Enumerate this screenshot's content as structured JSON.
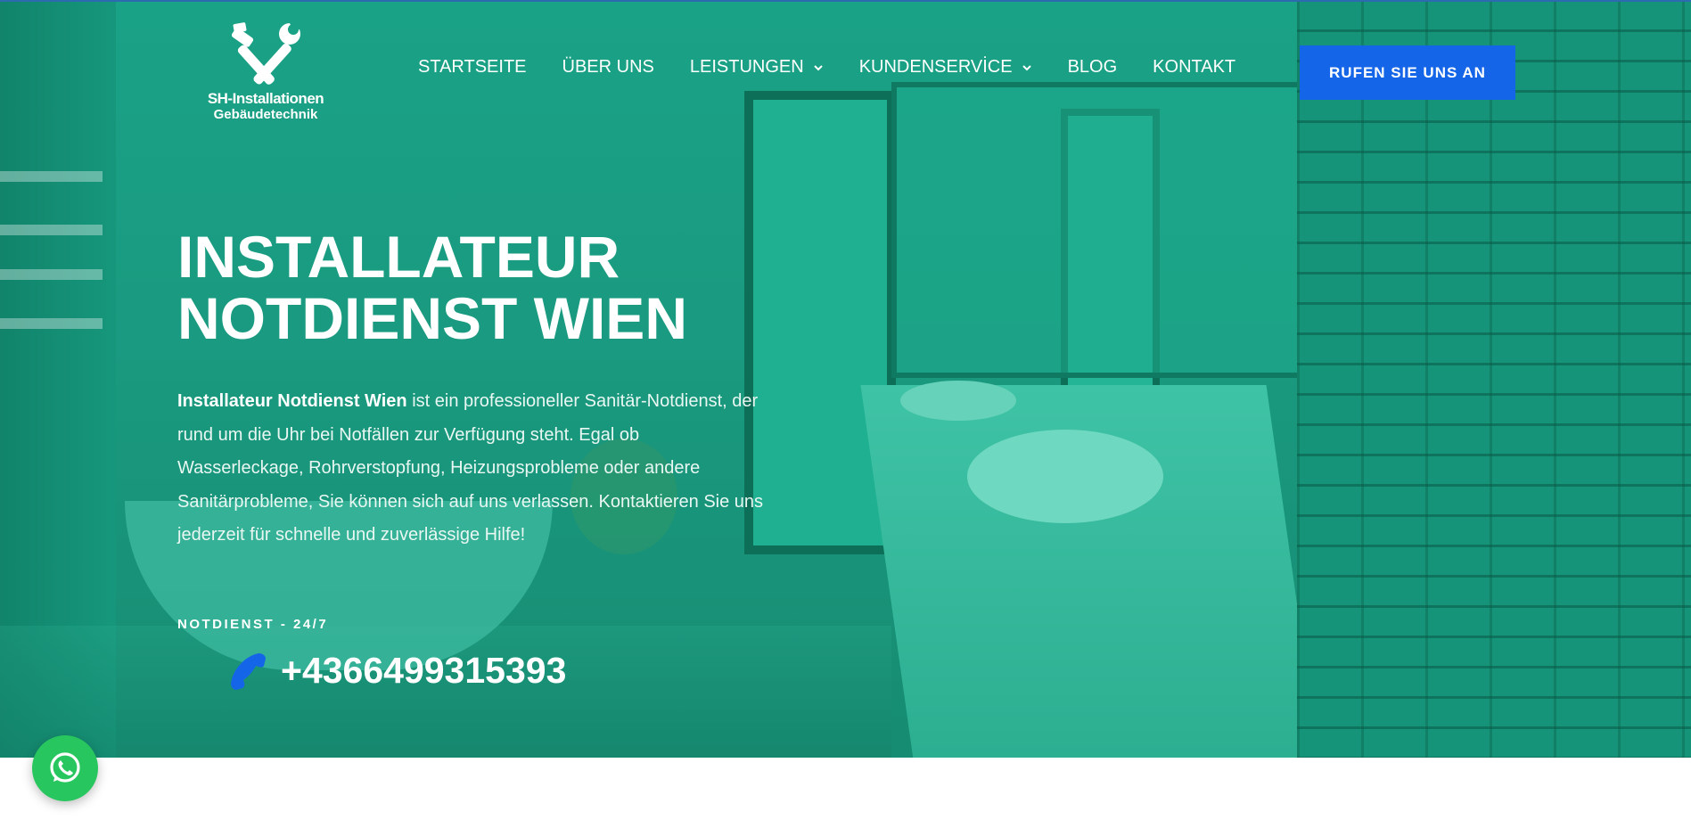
{
  "logo": {
    "line1": "SH-Installationen",
    "line2": "Gebäudetechnik",
    "icon": "wrench-and-pipe-wrench-icon"
  },
  "nav": {
    "items": [
      {
        "label": "STARTSEITE",
        "dropdown": false
      },
      {
        "label": "ÜBER UNS",
        "dropdown": false
      },
      {
        "label": "LEISTUNGEN",
        "dropdown": true
      },
      {
        "label": "KUNDENSERVİCE",
        "dropdown": true
      },
      {
        "label": "BLOG",
        "dropdown": false
      },
      {
        "label": "KONTAKT",
        "dropdown": false
      }
    ],
    "cta_label": "RUFEN SIE UNS AN"
  },
  "hero": {
    "title_line1": "INSTALLATEUR",
    "title_line2": "NOTDIENST WIEN",
    "description_bold": "Installateur Notdienst Wien",
    "description_rest": " ist ein professioneller Sanitär-Notdienst, der rund um die Uhr bei Notfällen zur Verfügung steht. Egal ob Wasserleckage, Rohrverstopfung, Heizungsprobleme oder andere Sanitärprobleme, Sie können sich auf uns verlassen. Kontaktieren Sie uns jederzeit für schnelle und zuverlässige Hilfe!",
    "emergency_label": "NOTDIENST - 24/7",
    "phone": "+4366499315393",
    "phone_icon": "phone-icon"
  },
  "widgets": {
    "whatsapp_icon": "whatsapp-icon"
  },
  "colors": {
    "hero_overlay": "#1aa286",
    "cta_blue": "#1565e8",
    "whatsapp_green": "#28c65e",
    "text": "#ffffff"
  }
}
